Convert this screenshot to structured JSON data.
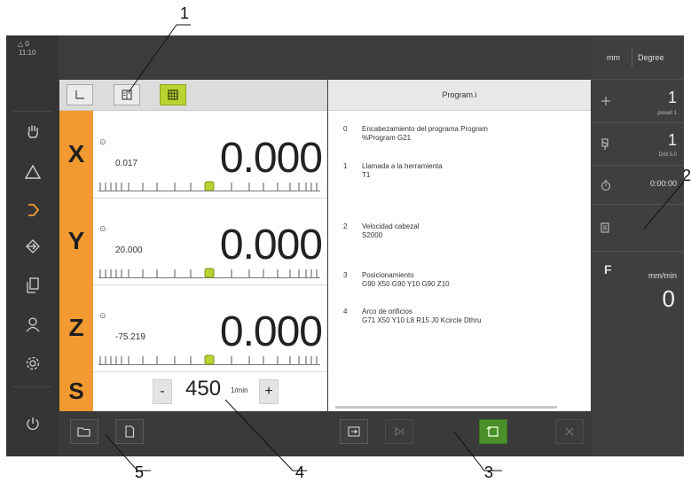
{
  "callouts": [
    "1",
    "2",
    "3",
    "4",
    "5"
  ],
  "statusbar": {
    "indicator": "△ 0",
    "time": "11:10"
  },
  "sidebar": {
    "items": [
      {
        "name": "manual-operation",
        "icon": "hand-icon"
      },
      {
        "name": "mdi",
        "icon": "triangle-icon"
      },
      {
        "name": "program-run",
        "icon": "arrow-right-icon"
      },
      {
        "name": "programming",
        "icon": "arrow-in-icon"
      },
      {
        "name": "file-management",
        "icon": "documents-icon"
      },
      {
        "name": "user-login",
        "icon": "user-icon"
      },
      {
        "name": "settings",
        "icon": "gear-icon"
      },
      {
        "name": "power",
        "icon": "power-icon"
      }
    ]
  },
  "topbar": {
    "unit_length": "mm",
    "unit_angle": "Degree"
  },
  "axes": [
    {
      "letter": "X",
      "small": "0.017",
      "value": "0.000"
    },
    {
      "letter": "Y",
      "small": "20.000",
      "value": "0.000"
    },
    {
      "letter": "Z",
      "small": "-75.219",
      "value": "0.000"
    }
  ],
  "spindle": {
    "letter": "S",
    "minus": "-",
    "value": "450",
    "unit": "1/min",
    "plus": "+"
  },
  "program": {
    "title": "Program.i",
    "steps": [
      {
        "num": "0",
        "l1": "Encabezamiento del programa Program",
        "l2": "%Program G21"
      },
      {
        "num": "1",
        "l1": "Llamada a la herramienta",
        "l2": "T1"
      },
      {
        "num": "2",
        "l1": "Velocidad cabezal",
        "l2": "S2000"
      },
      {
        "num": "3",
        "l1": "Posicionamiento",
        "l2": "G90 X50 G90 Y10 G90 Z10"
      },
      {
        "num": "4",
        "l1": "Arco de orificios",
        "l2": "G71 X50 Y10 L8 R15 J0 Kcircle Dthru"
      }
    ]
  },
  "right_panel": {
    "preset_value": "1",
    "preset_label": "preset 1",
    "tool_value": "1",
    "tool_label": "Drill 5.0",
    "timer": "0:00:00",
    "feed_letter": "F",
    "feed_unit": "mm/min",
    "feed_value": "0"
  },
  "colors": {
    "axis_orange": "#f29a31",
    "active_green": "#b7d433",
    "screen_dark": "#3a3a3a"
  }
}
